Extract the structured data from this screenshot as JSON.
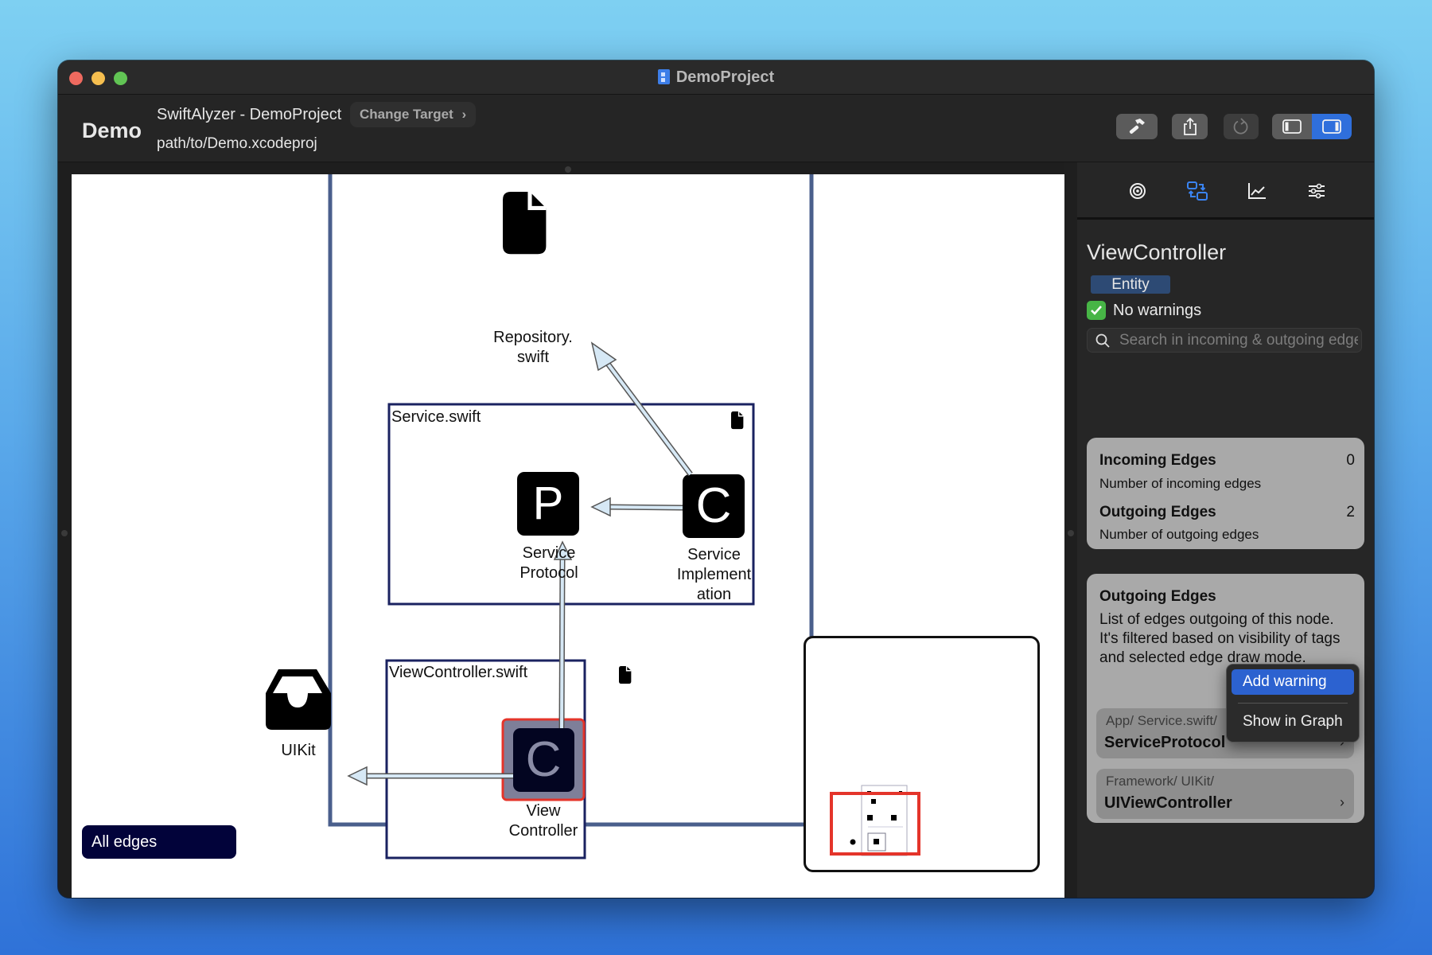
{
  "window": {
    "title": "DemoProject",
    "title_icon": "xcode-project-icon"
  },
  "toolbar": {
    "app_name": "Demo",
    "project_title": "SwiftAlyzer - DemoProject",
    "change_target_label": "Change Target",
    "project_path": "path/to/Demo.xcodeproj",
    "buttons": [
      {
        "name": "build",
        "icon": "hammer-icon"
      },
      {
        "name": "share",
        "icon": "share-icon"
      },
      {
        "name": "refresh",
        "icon": "refresh-icon",
        "enabled": false
      },
      {
        "name": "toggle-left-panel",
        "icon": "sidebar-left-icon",
        "active": false
      },
      {
        "name": "toggle-right-panel",
        "icon": "sidebar-right-icon",
        "active": true
      }
    ]
  },
  "graph": {
    "containers": [
      {
        "label": "",
        "kind": "module"
      },
      {
        "label": "Service.swift",
        "kind": "file"
      },
      {
        "label": "ViewController.swift",
        "kind": "file"
      }
    ],
    "nodes": [
      {
        "id": "repository",
        "glyph": "file",
        "label_lines": [
          "Repository.",
          "swift"
        ]
      },
      {
        "id": "service-protocol",
        "glyph": "P",
        "label_lines": [
          "Service",
          "Protocol"
        ]
      },
      {
        "id": "service-implementation",
        "glyph": "C",
        "label_lines": [
          "Service",
          "Implement",
          "ation"
        ]
      },
      {
        "id": "view-controller",
        "glyph": "C",
        "label_lines": [
          "View",
          "Controller"
        ],
        "selected": true
      },
      {
        "id": "uikit",
        "glyph": "tray",
        "label_lines": [
          "UIKit"
        ]
      }
    ],
    "edges": [
      {
        "from": "service-implementation",
        "to": "repository"
      },
      {
        "from": "service-implementation",
        "to": "service-protocol"
      },
      {
        "from": "view-controller",
        "to": "service-protocol"
      },
      {
        "from": "view-controller",
        "to": "uikit"
      }
    ],
    "edge_mode_label": "All edges",
    "colors": {
      "container_stroke": "#4a5f8c",
      "file_box_stroke": "#1a2260",
      "edge_fill": "#d6e8f5",
      "selection": "#e4342a",
      "edge_mode_bg": "#02033a"
    }
  },
  "sidebar": {
    "tabs": [
      {
        "name": "overview",
        "icon": "target-icon",
        "active": false
      },
      {
        "name": "edges",
        "icon": "edges-swap-icon",
        "active": true
      },
      {
        "name": "metrics",
        "icon": "chart-icon",
        "active": false
      },
      {
        "name": "settings",
        "icon": "sliders-icon",
        "active": false
      }
    ],
    "node_title": "ViewController",
    "badge": "Entity",
    "warning_status": "No warnings",
    "search_placeholder": "Search in incoming & outgoing edges",
    "stats": [
      {
        "title": "Incoming Edges",
        "value": "0",
        "description": "Number of incoming edges"
      },
      {
        "title": "Outgoing Edges",
        "value": "2",
        "description": "Number of outgoing edges"
      }
    ],
    "outgoing": {
      "title": "Outgoing Edges",
      "description": "List of edges outgoing of this node. It's filtered based on visibility of tags and selected edge draw mode.",
      "items": [
        {
          "path": "App/ Service.swift/",
          "name": "ServiceProtocol"
        },
        {
          "path": "Framework/ UIKit/",
          "name": "UIViewController"
        }
      ]
    },
    "context_menu": {
      "items": [
        {
          "label": "Add warning",
          "highlighted": true
        },
        {
          "label": "Show in Graph",
          "highlighted": false
        }
      ]
    },
    "accent_color": "#2f6fdc"
  }
}
